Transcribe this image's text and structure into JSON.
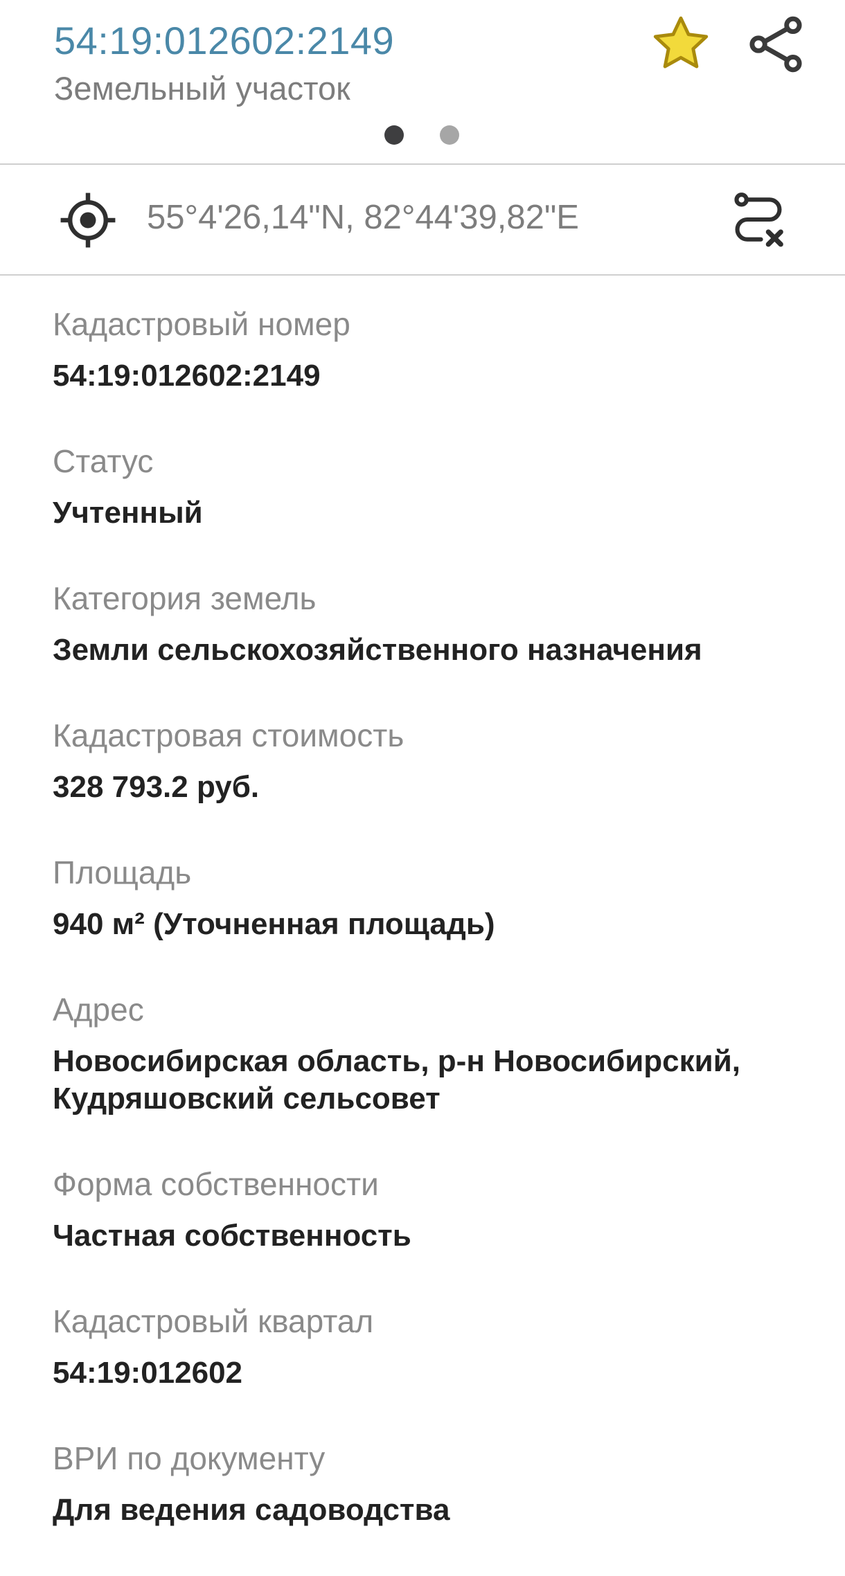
{
  "header": {
    "title": "54:19:012602:2149",
    "subtitle": "Земельный участок",
    "star_color": "#d4b320",
    "star_stroke": "#b8960a",
    "pager": {
      "count": 2,
      "active_index": 0
    }
  },
  "location": {
    "coordinates": "55°4'26,14\"N, 82°44'39,82\"E"
  },
  "fields": [
    {
      "label": "Кадастровый номер",
      "value": "54:19:012602:2149"
    },
    {
      "label": "Статус",
      "value": "Учтенный"
    },
    {
      "label": "Категория земель",
      "value": "Земли сельскохозяйственного назначения"
    },
    {
      "label": "Кадастровая стоимость",
      "value": "328 793.2 руб."
    },
    {
      "label": "Площадь",
      "value": "940 м² (Уточненная площадь)"
    },
    {
      "label": "Адрес",
      "value": "Новосибирская область, р-н Новосибирский, Кудряшовский сельсовет"
    },
    {
      "label": "Форма собственности",
      "value": "Частная собственность"
    },
    {
      "label": "Кадастровый квартал",
      "value": "54:19:012602"
    },
    {
      "label": "ВРИ по документу",
      "value": "Для ведения садоводства"
    }
  ],
  "icons": {
    "favorite": "star-icon",
    "share": "share-icon",
    "location": "crosshair-target-icon",
    "route": "route-cancel-icon"
  }
}
